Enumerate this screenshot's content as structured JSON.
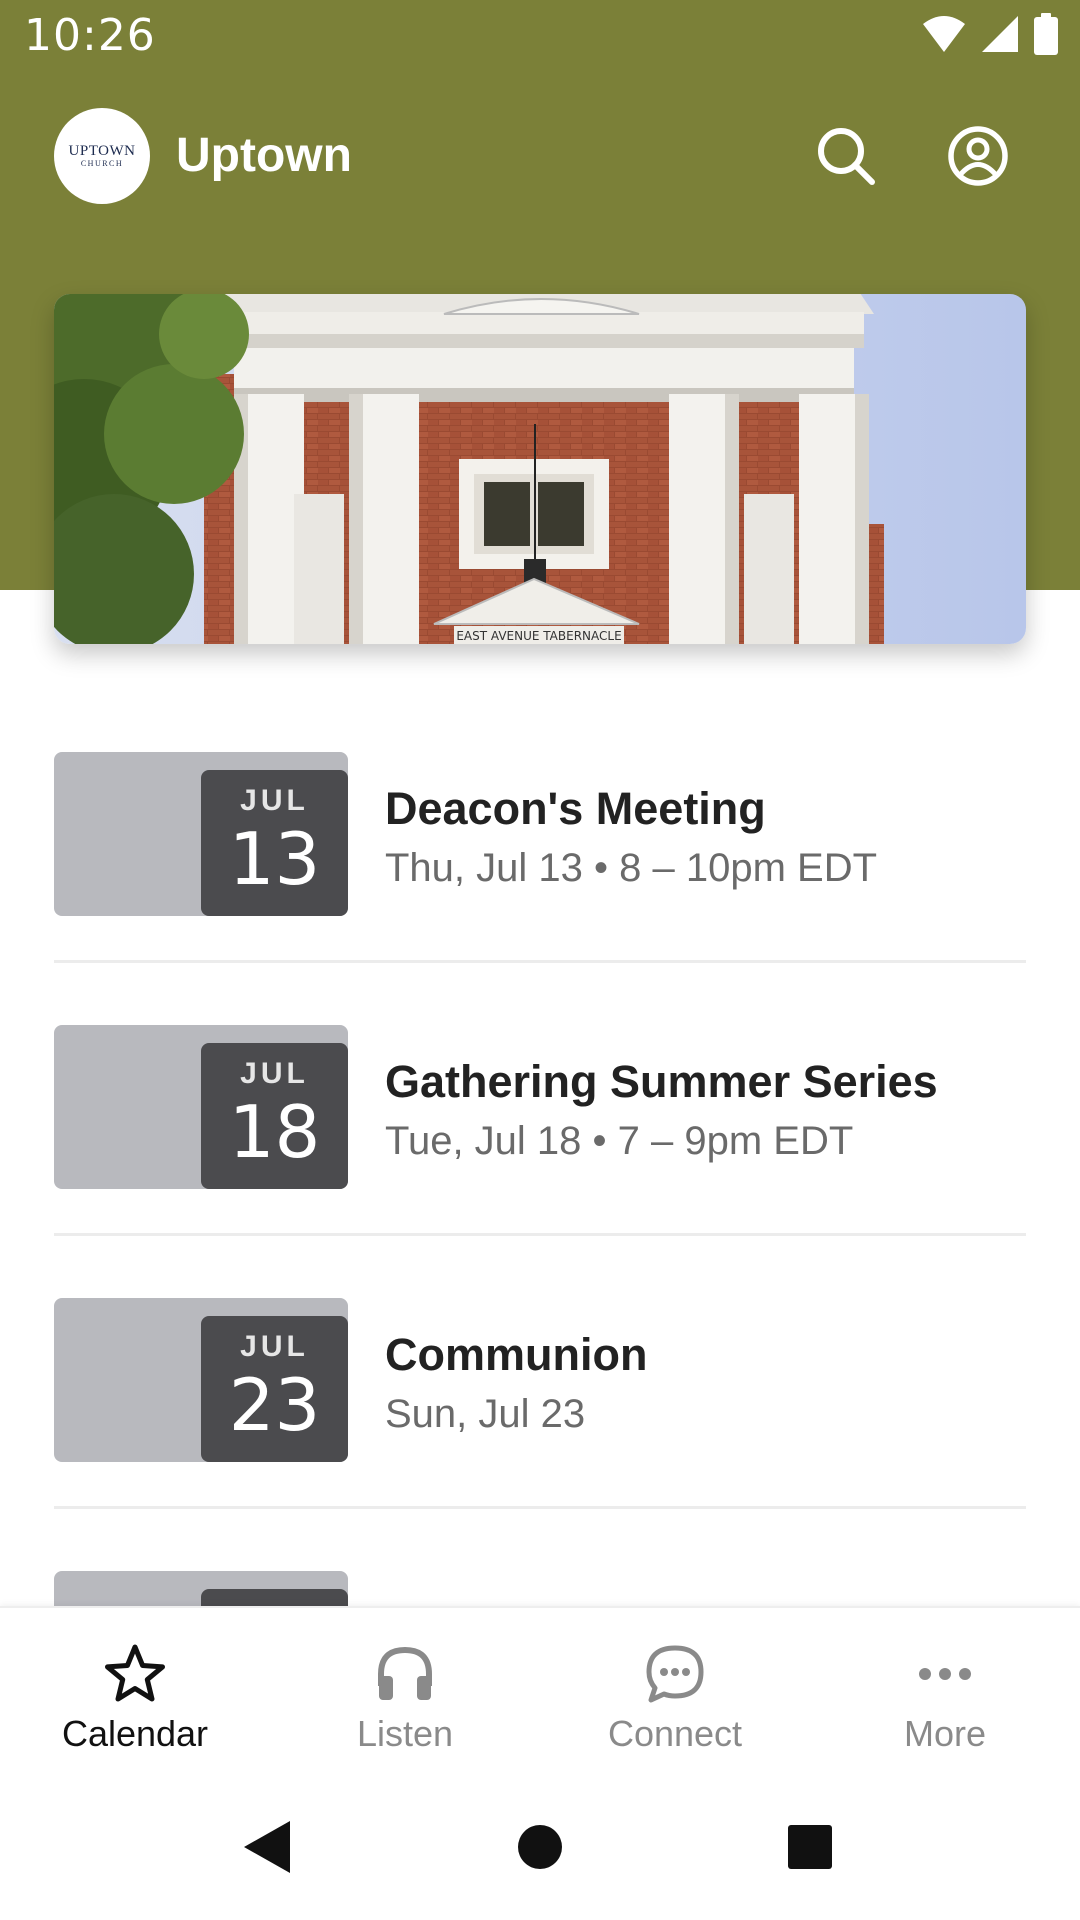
{
  "status_bar": {
    "time": "10:26"
  },
  "app_bar": {
    "logo_word": "UPTOWN",
    "logo_sub": "CHURCH",
    "title": "Uptown"
  },
  "hero": {
    "sign_text": "EAST AVENUE TABERNACLE"
  },
  "events": [
    {
      "month": "JUL",
      "day": "13",
      "title": "Deacon's Meeting",
      "subtitle": "Thu, Jul 13 • 8 – 10pm EDT"
    },
    {
      "month": "JUL",
      "day": "18",
      "title": "Gathering Summer Series",
      "subtitle": "Tue, Jul 18 • 7 – 9pm EDT"
    },
    {
      "month": "JUL",
      "day": "23",
      "title": "Communion",
      "subtitle": "Sun, Jul 23"
    }
  ],
  "tabs": [
    {
      "label": "Calendar",
      "icon": "star-icon",
      "active": true
    },
    {
      "label": "Listen",
      "icon": "headphones-icon",
      "active": false
    },
    {
      "label": "Connect",
      "icon": "chat-bubble-icon",
      "active": false
    },
    {
      "label": "More",
      "icon": "more-dots-icon",
      "active": false
    }
  ],
  "colors": {
    "header": "#7b8038",
    "badge": "#4b4b4e",
    "thumb": "#b8b9be"
  }
}
